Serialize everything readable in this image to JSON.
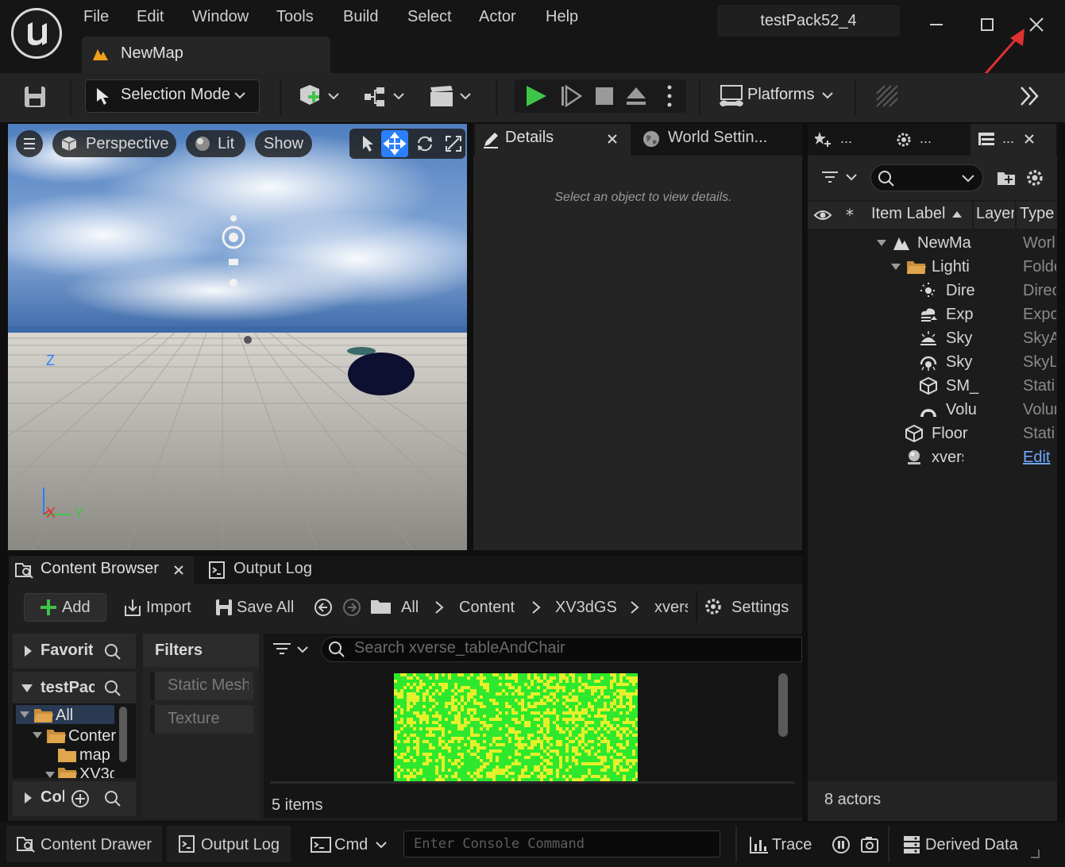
{
  "menu": [
    "File",
    "Edit",
    "Window",
    "Tools",
    "Build",
    "Select",
    "Actor",
    "Help"
  ],
  "project_name": "testPack52_4",
  "map_tab": "NewMap",
  "toolbar": {
    "selection_mode": "Selection Mode",
    "platforms": "Platforms"
  },
  "viewport": {
    "perspective": "Perspective",
    "lit": "Lit",
    "show": "Show",
    "axis_z": "Z",
    "axis_x": "X",
    "axis_y": "Y"
  },
  "details": {
    "tab_details": "Details",
    "tab_world": "World Settin...",
    "empty_message": "Select an object to view details."
  },
  "outliner": {
    "tab_ellipsis": "...",
    "headers": {
      "label": "Item Label",
      "layer": "Layer",
      "type": "Type"
    },
    "rows": [
      {
        "label": "NewMa",
        "type": "Worl"
      },
      {
        "label": "Lighti",
        "type": "Folde"
      },
      {
        "label": "Dire",
        "type": "Direc"
      },
      {
        "label": "Exp",
        "type": "Expo"
      },
      {
        "label": "Sky",
        "type": "SkyA"
      },
      {
        "label": "Sky",
        "type": "SkyL"
      },
      {
        "label": "SM_",
        "type": "Stati"
      },
      {
        "label": "Volu",
        "type": "Volur"
      },
      {
        "label": "Floor",
        "type": "Stati"
      },
      {
        "label": "xverse",
        "type": "Edit"
      }
    ],
    "footer": "8 actors"
  },
  "content_browser": {
    "tab_content": "Content Browser",
    "tab_output": "Output Log",
    "add": "Add",
    "import": "Import",
    "save_all": "Save All",
    "breadcrumb": [
      "All",
      "Content",
      "XV3dGS",
      "xvers"
    ],
    "settings": "Settings",
    "favorites": "Favorite",
    "project_root": "testPac",
    "tree": [
      "All",
      "Conter",
      "map",
      "XV3c"
    ],
    "collections": "Col",
    "filters_title": "Filters",
    "filters": [
      "Static Mesh",
      "Texture"
    ],
    "search_placeholder": "Search xverse_tableAndChair",
    "items_count": "5 items"
  },
  "statusbar": {
    "content_drawer": "Content Drawer",
    "output_log": "Output Log",
    "cmd": "Cmd",
    "console_placeholder": "Enter Console Command",
    "trace": "Trace",
    "derived_data": "Derived Data"
  },
  "colors": {
    "play_green": "#3fc44a",
    "accent_blue": "#2a7fff",
    "annotation_red": "#e03131",
    "thumb_green": "#2ee82e",
    "thumb_yellow": "#e6f02a"
  }
}
